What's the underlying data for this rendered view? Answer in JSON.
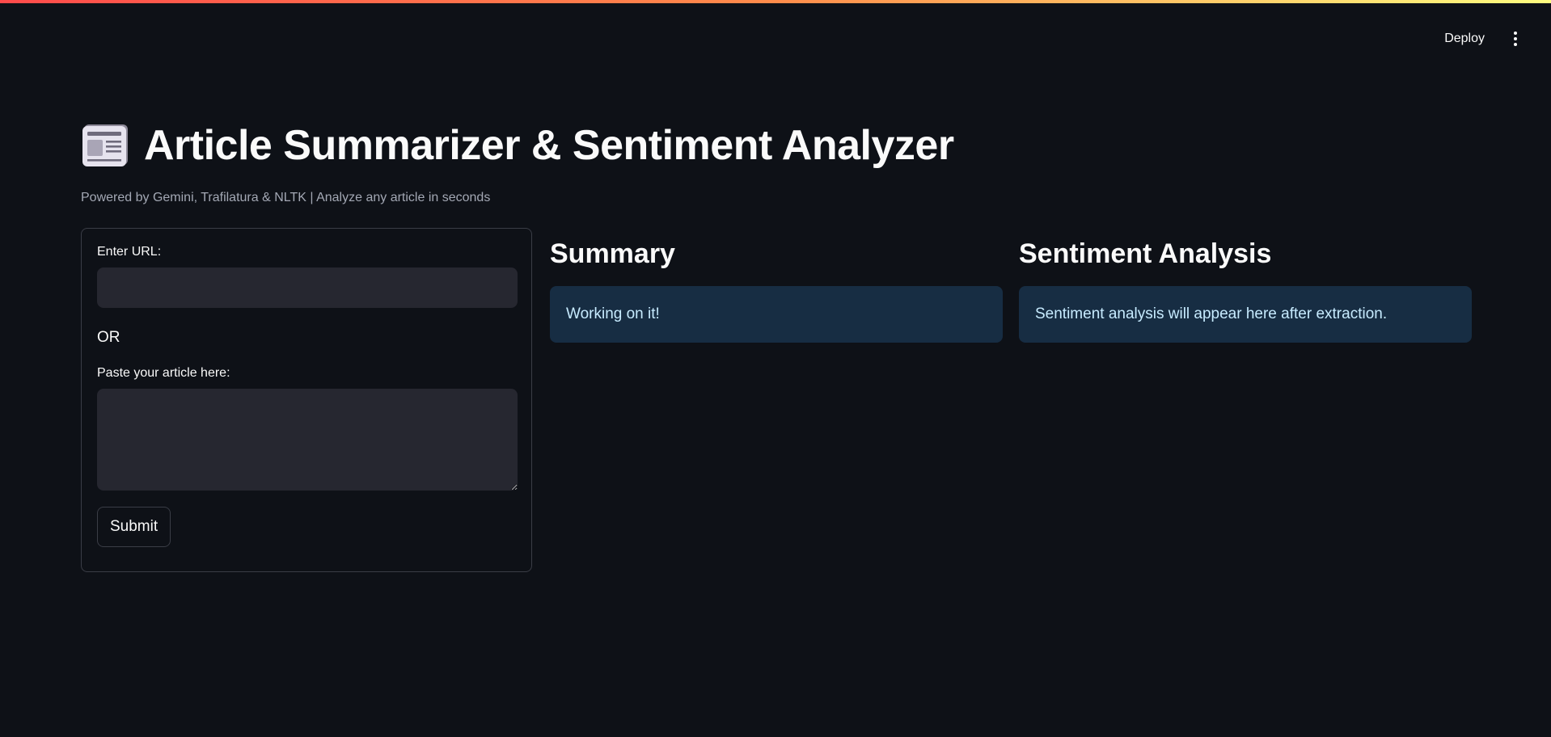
{
  "header": {
    "deploy_label": "Deploy",
    "menu_icon": "kebab-menu-icon"
  },
  "app": {
    "title_icon": "newspaper-icon",
    "title": "Article Summarizer & Sentiment Analyzer",
    "subtitle": "Powered by Gemini, Trafilatura & NLTK | Analyze any article in seconds"
  },
  "form": {
    "url_label": "Enter URL:",
    "url_value": "",
    "or_text": "OR",
    "article_label": "Paste your article here:",
    "article_value": "",
    "submit_label": "Submit"
  },
  "summary": {
    "heading": "Summary",
    "status": "Working on it!"
  },
  "sentiment": {
    "heading": "Sentiment Analysis",
    "status": "Sentiment analysis will appear here after extraction."
  },
  "colors": {
    "background": "#0e1117",
    "input_background": "#262730",
    "info_background": "#172d43",
    "info_text": "#c7ebff",
    "subtitle_text": "#a3a8b4"
  }
}
